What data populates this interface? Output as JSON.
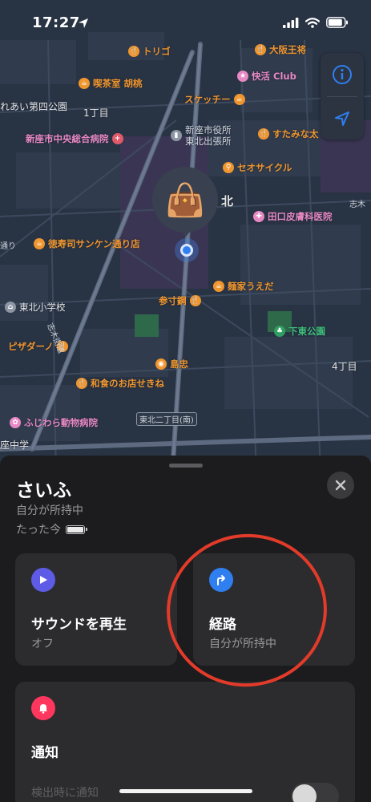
{
  "status_bar": {
    "time": "17:27",
    "icons": [
      "location-arrow-icon",
      "cellular-signal-icon",
      "wifi-icon",
      "battery-icon"
    ]
  },
  "map": {
    "controls": {
      "info_icon": "info-icon",
      "locate_icon": "location-arrow-icon"
    },
    "pois": [
      {
        "name": "トリゴ",
        "color": "orange",
        "icon": "fork-knife"
      },
      {
        "name": "大阪王将",
        "color": "orange",
        "icon": "fork-knife"
      },
      {
        "name": "喫茶室 胡桃",
        "color": "orange",
        "icon": "cup"
      },
      {
        "name": "快活 Club",
        "color": "pink",
        "icon": "star"
      },
      {
        "name": "スケッチー",
        "color": "orange",
        "icon": "cup"
      },
      {
        "name": "すたみな太",
        "color": "orange",
        "icon": "fork-knife"
      },
      {
        "name": "新座市中央総合病院",
        "color": "pink",
        "icon": "cross"
      },
      {
        "name": "新座市役所\n東北出張所",
        "color": "gray",
        "icon": "building"
      },
      {
        "name": "セオサイクル",
        "color": "orange",
        "icon": "bicycle"
      },
      {
        "name": "田口皮膚科医院",
        "color": "pink",
        "icon": "tooth"
      },
      {
        "name": "徳寿司サンケン通り店",
        "color": "orange",
        "icon": "cup"
      },
      {
        "name": "麺家うえだ",
        "color": "orange",
        "icon": "cup"
      },
      {
        "name": "参寸鋼",
        "color": "orange",
        "icon": "fork-knife"
      },
      {
        "name": "東北小学校",
        "color": "white",
        "icon": "school"
      },
      {
        "name": "下東公園",
        "color": "green",
        "icon": "tree"
      },
      {
        "name": "ピザダーノ",
        "color": "orange",
        "icon": "fork-knife"
      },
      {
        "name": "島忠",
        "color": "orange",
        "icon": "bag"
      },
      {
        "name": "和食のお店せきね",
        "color": "orange",
        "icon": "fork-knife"
      },
      {
        "name": "ふじわら動物病院",
        "color": "pink",
        "icon": "paw"
      }
    ],
    "labels": {
      "block_1": "1丁目",
      "block_4": "4丁目",
      "park_partial": "れあい第四公園",
      "area_big": "北",
      "road_1": "通り",
      "road_2": "志木街道",
      "intersection": "東北二丁目(南)",
      "school_partial": "座中学",
      "edge_1": "志木",
      "top_partial": "志木"
    },
    "pin_emoji": "👜"
  },
  "sheet": {
    "item_name": "さいふ",
    "owner_status": "自分が所持中",
    "updated": "たった今",
    "battery_level": 1.0,
    "cards": {
      "sound": {
        "title": "サウンドを再生",
        "subtitle": "オフ",
        "icon": "play-icon",
        "color": "#5e5ce6"
      },
      "directions": {
        "title": "経路",
        "subtitle": "自分が所持中",
        "icon": "turn-right-arrow-icon",
        "color": "#2f7ff0"
      },
      "notify": {
        "title": "通知",
        "row_label": "検出時に通知",
        "icon": "bell-icon",
        "color": "#ff375f",
        "toggle_on": false
      }
    }
  },
  "colors": {
    "accent_blue": "#2f7ff0",
    "annotation_red": "#e23b2a",
    "sheet_bg": "#1c1c1e",
    "card_bg": "#2c2c2e"
  }
}
